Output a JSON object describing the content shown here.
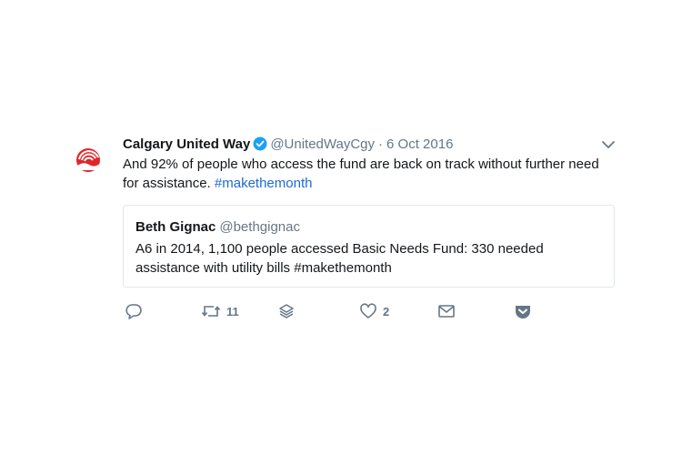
{
  "tweet": {
    "display_name": "Calgary United Way",
    "handle": "@UnitedWayCgy",
    "separator": "·",
    "date": "6 Oct 2016",
    "text_main": "And 92% of people who access the fund are back on track without further need for assistance.",
    "hashtag": "#makethemonth",
    "avatar_icon": "united-way-logo-icon",
    "brand_color": "#e0262b",
    "link_color": "#1b6ad6",
    "verified_color": "#1da1f2"
  },
  "quote": {
    "display_name": "Beth Gignac",
    "handle": "@bethgignac",
    "text": "A6 in 2014, 1,100 people accessed Basic Needs Fund: 330 needed assistance with utility bills #makethemonth"
  },
  "actions": {
    "reply_icon": "reply-icon",
    "retweet_icon": "retweet-icon",
    "retweet_count": "11",
    "stack_icon": "layers-icon",
    "like_icon": "heart-icon",
    "like_count": "2",
    "message_icon": "envelope-icon",
    "pocket_icon": "pocket-icon"
  }
}
